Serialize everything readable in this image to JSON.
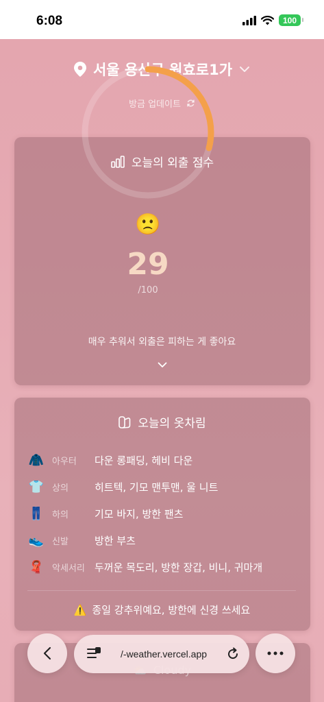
{
  "status_bar": {
    "time": "6:08",
    "battery": "100"
  },
  "header": {
    "location": "서울 용산구 원효로1가",
    "updated": "방금 업데이트"
  },
  "score_card": {
    "title": "오늘의 외출 점수",
    "emoji": "🙁",
    "score": "29",
    "max": "/100",
    "score_value": 29,
    "score_max": 100,
    "message": "매우 추워서 외출은 피하는 게 좋아요",
    "accent_color": "#f4a04a"
  },
  "outfit_card": {
    "title": "오늘의 옷차림",
    "items": [
      {
        "icon": "coat-icon",
        "glyph": "🧥",
        "category": "아우터",
        "value": "다운 롱패딩, 헤비 다운"
      },
      {
        "icon": "shirt-icon",
        "glyph": "👕",
        "category": "상의",
        "value": "히트텍, 기모 맨투맨, 울 니트"
      },
      {
        "icon": "jeans-icon",
        "glyph": "👖",
        "category": "하의",
        "value": "기모 바지, 방한 팬츠"
      },
      {
        "icon": "sneaker-icon",
        "glyph": "👟",
        "category": "신발",
        "value": "방한 부츠"
      },
      {
        "icon": "scarf-icon",
        "glyph": "🧣",
        "category": "악세서리",
        "value": "두꺼운 목도리, 방한 장갑, 비니, 귀마개"
      }
    ],
    "warning": "종일 강추위예요, 방한에 신경 쓰세요"
  },
  "next_card": {
    "label": "Cloudy"
  },
  "browser": {
    "url": "/-weather.vercel.app"
  }
}
